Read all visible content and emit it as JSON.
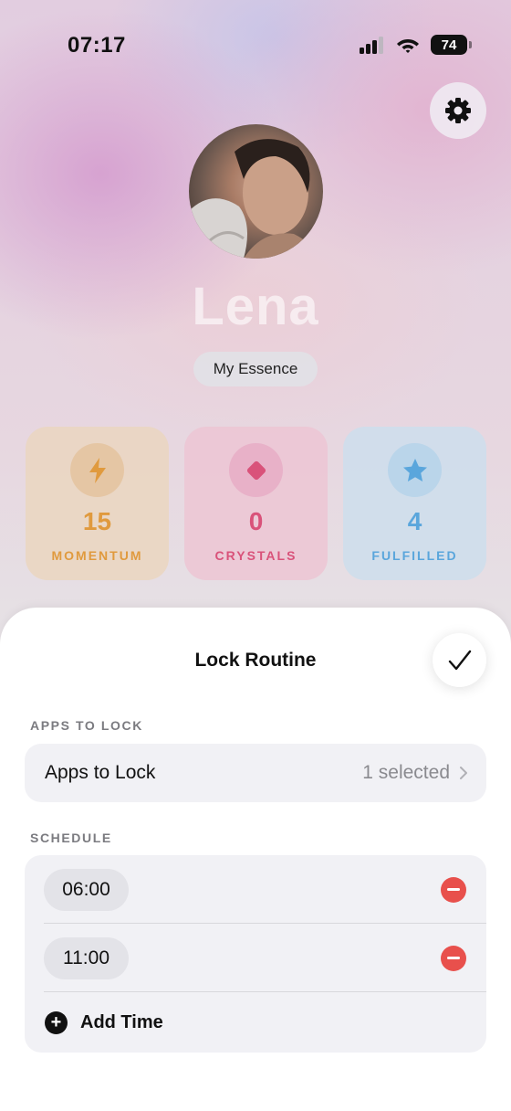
{
  "status_bar": {
    "time": "07:17",
    "battery": "74",
    "icons": [
      "signal-icon",
      "wifi-icon",
      "battery-icon"
    ]
  },
  "header": {
    "settings_icon": "gear-icon",
    "profile_name": "Lena",
    "essence_button": "My Essence"
  },
  "stats": [
    {
      "value": "15",
      "label": "MOMENTUM",
      "icon": "lightning-icon",
      "color": "#e09a3e"
    },
    {
      "value": "0",
      "label": "CRYSTALS",
      "icon": "diamond-icon",
      "color": "#d9527a"
    },
    {
      "value": "4",
      "label": "FULFILLED",
      "icon": "star-icon",
      "color": "#5aa6dc"
    }
  ],
  "sheet": {
    "title": "Lock Routine",
    "confirm_icon": "checkmark-icon",
    "apps_section": {
      "header": "APPS TO LOCK",
      "row_label": "Apps to Lock",
      "row_value": "1 selected"
    },
    "schedule_section": {
      "header": "SCHEDULE",
      "times": [
        "06:00",
        "11:00"
      ],
      "add_label": "Add Time"
    }
  }
}
